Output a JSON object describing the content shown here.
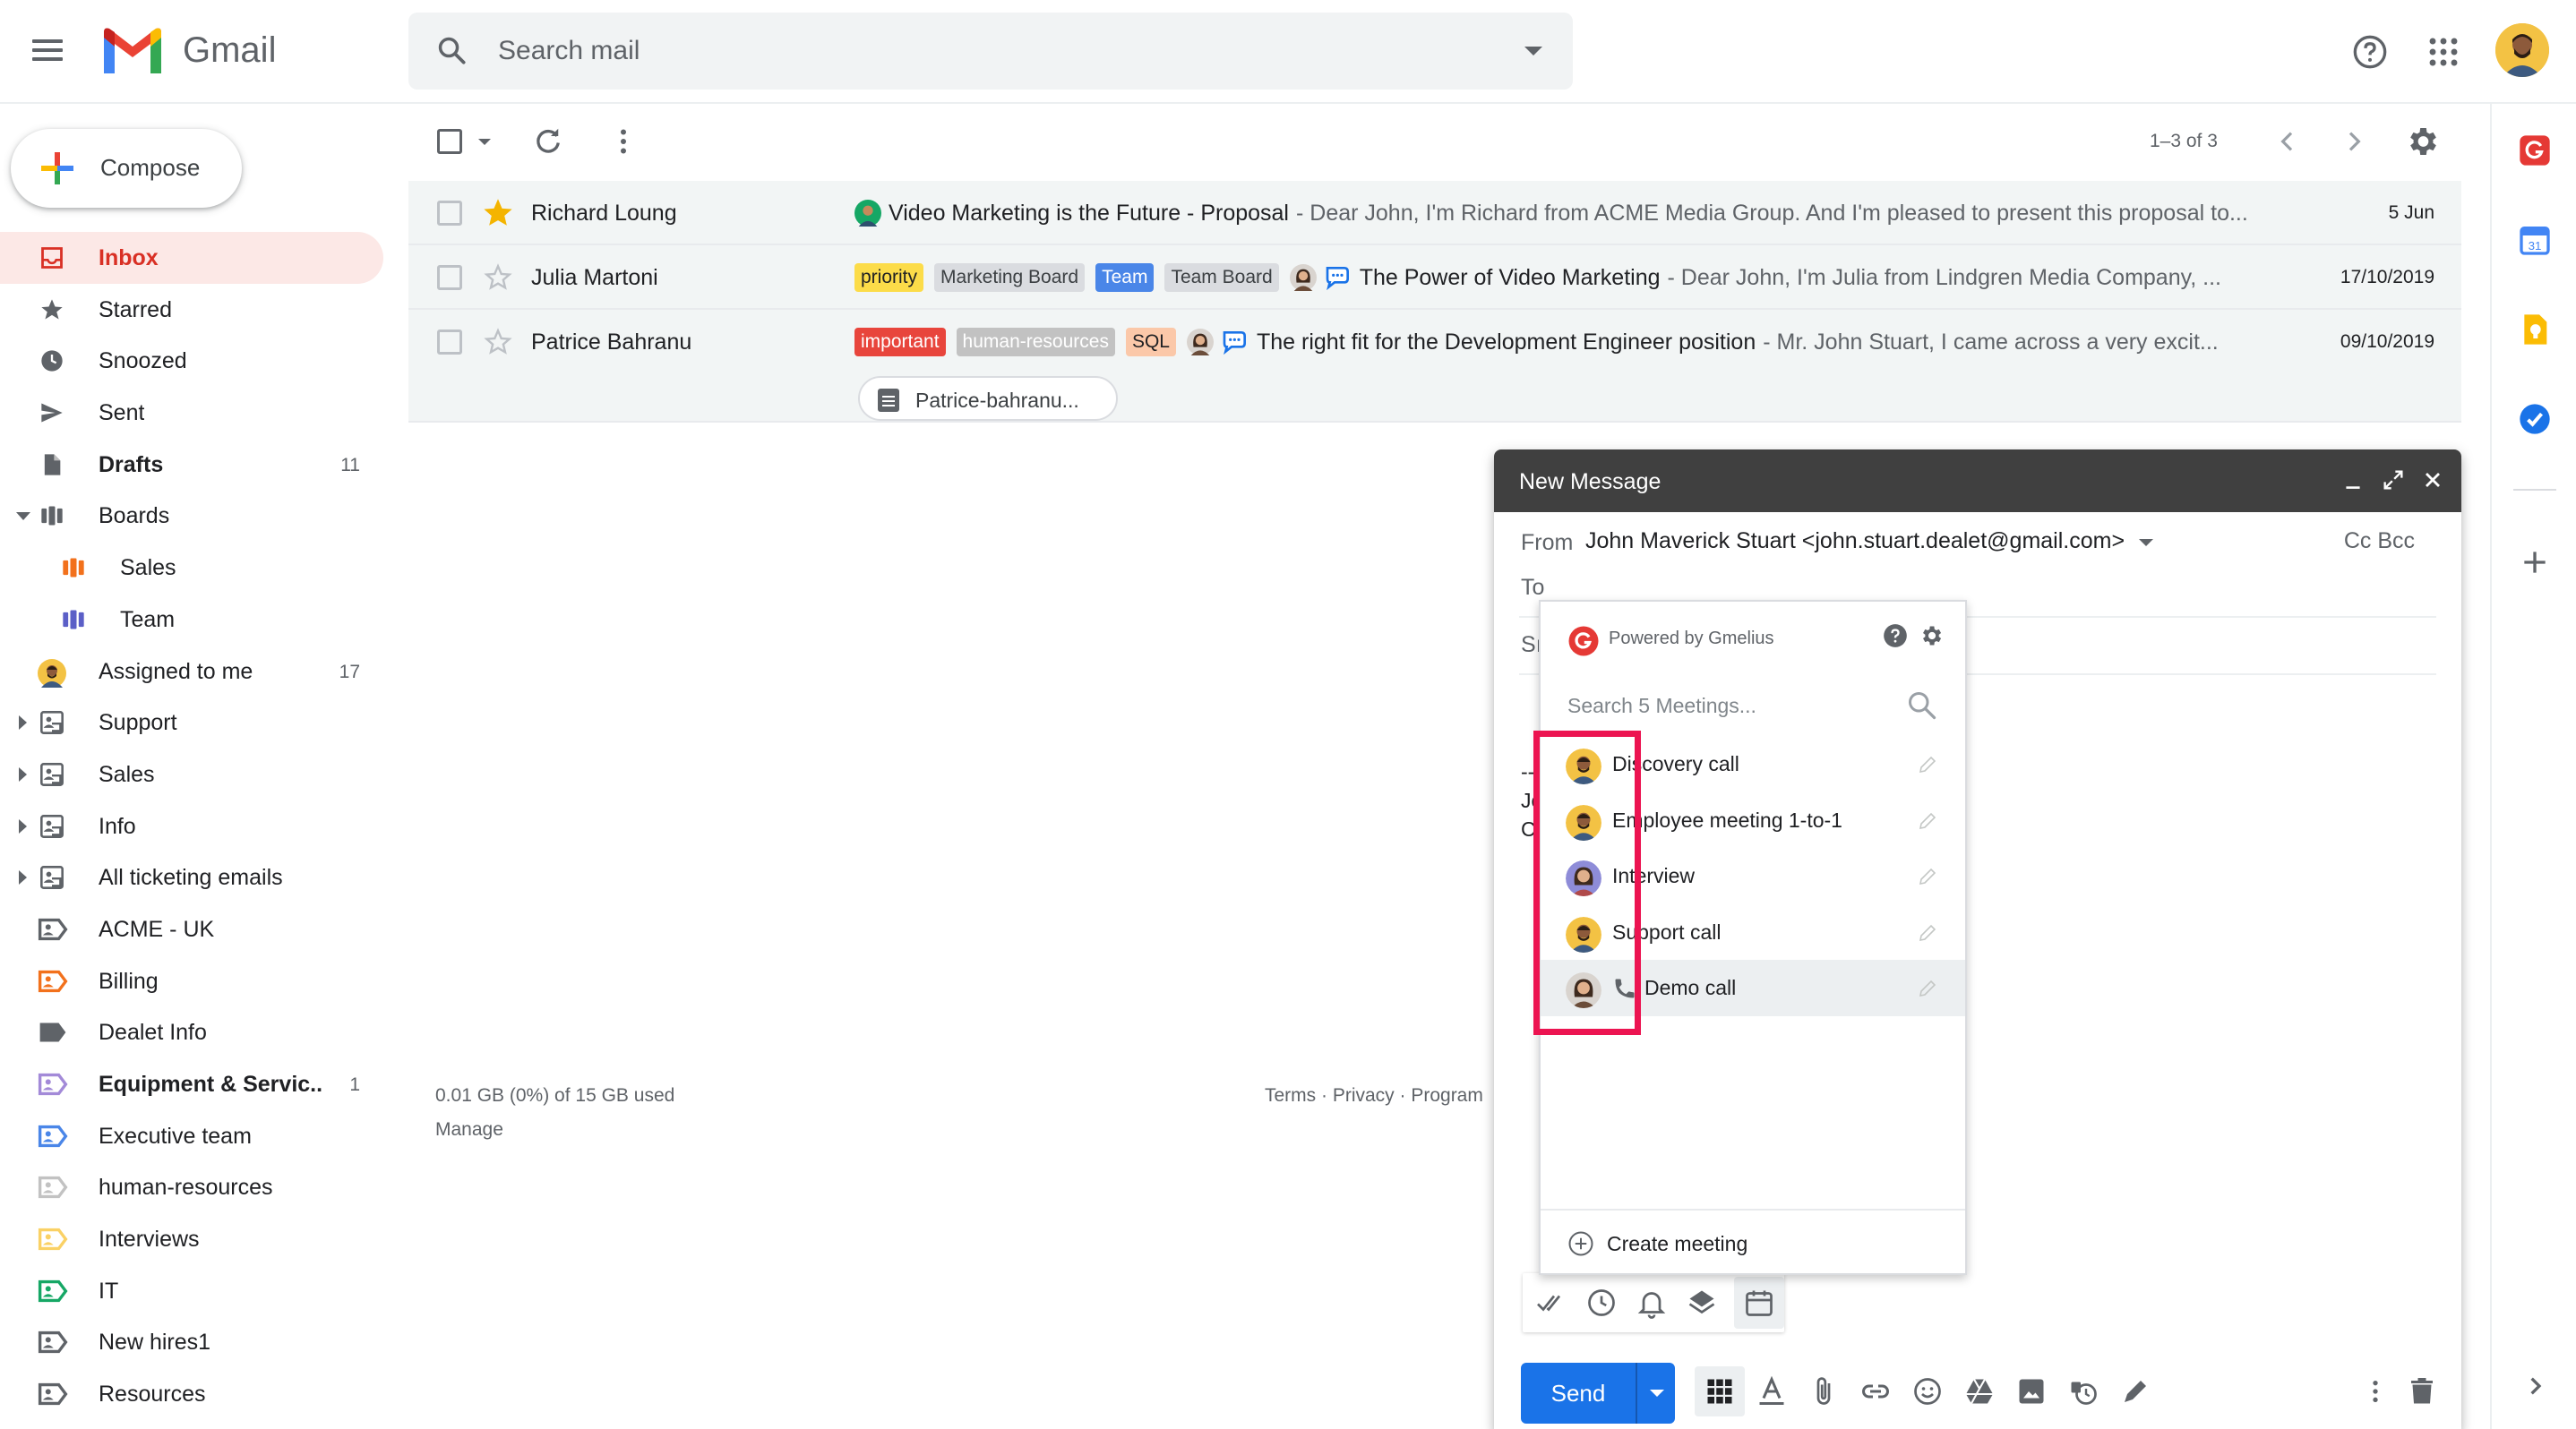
{
  "header": {
    "app_name": "Gmail",
    "search_placeholder": "Search mail"
  },
  "sidebar": {
    "compose_label": "Compose",
    "items": [
      {
        "label": "Inbox",
        "icon": "inbox-icon",
        "active": true
      },
      {
        "label": "Starred",
        "icon": "star-icon"
      },
      {
        "label": "Snoozed",
        "icon": "clock-icon"
      },
      {
        "label": "Sent",
        "icon": "send-icon"
      },
      {
        "label": "Drafts",
        "icon": "draft-icon",
        "count": "11",
        "bold": true
      },
      {
        "label": "Boards",
        "icon": "board-icon",
        "expanded": true
      },
      {
        "label": "Sales",
        "icon": "board-icon",
        "child": true,
        "color": "#f2711c"
      },
      {
        "label": "Team",
        "icon": "board-icon",
        "child": true,
        "color": "#5b5fc7"
      },
      {
        "label": "Assigned to me",
        "icon": "avatar-icon",
        "count": "17"
      },
      {
        "label": "Support",
        "icon": "shared-inbox-icon",
        "collapsed": true
      },
      {
        "label": "Sales",
        "icon": "shared-inbox-icon",
        "collapsed": true
      },
      {
        "label": "Info",
        "icon": "shared-inbox-icon",
        "collapsed": true
      },
      {
        "label": "All ticketing emails",
        "icon": "shared-inbox-icon",
        "collapsed": true
      },
      {
        "label": "ACME - UK",
        "icon": "shared-label-icon",
        "color": "#5f6368"
      },
      {
        "label": "Billing",
        "icon": "shared-label-icon",
        "color": "#f2711c"
      },
      {
        "label": "Dealet Info",
        "icon": "label-icon",
        "color": "#5f6368"
      },
      {
        "label": "Equipment & Servic...",
        "icon": "shared-label-icon",
        "color": "#a38ad8",
        "count": "1",
        "bold": true
      },
      {
        "label": "Executive team",
        "icon": "shared-label-icon",
        "color": "#4a86e8"
      },
      {
        "label": "human-resources",
        "icon": "shared-label-icon",
        "color": "#c2c2c2"
      },
      {
        "label": "Interviews",
        "icon": "shared-label-icon",
        "color": "#fad165"
      },
      {
        "label": "IT",
        "icon": "shared-label-icon",
        "color": "#16a765"
      },
      {
        "label": "New hires1",
        "icon": "shared-label-icon",
        "color": "#5f6368"
      },
      {
        "label": "Resources",
        "icon": "shared-label-icon",
        "color": "#5f6368"
      }
    ]
  },
  "toolbar": {
    "pager": "1–3 of 3"
  },
  "emails": [
    {
      "sender": "Richard Loung",
      "starred": true,
      "labels": [],
      "subject": "Video Marketing is the Future - Proposal",
      "snippet": " - Dear John, I'm Richard from ACME Media Group. And I'm pleased to present this proposal to...",
      "date": "5 Jun"
    },
    {
      "sender": "Julia Martoni",
      "starred": false,
      "labels": [
        {
          "text": "priority",
          "bg": "#fcdc49",
          "fg": "#202124"
        },
        {
          "text": "Marketing Board",
          "bg": "#dadce0",
          "fg": "#3c4043"
        },
        {
          "text": "Team",
          "bg": "#4a86e8",
          "fg": "#ffffff"
        },
        {
          "text": "Team Board",
          "bg": "#dadce0",
          "fg": "#3c4043"
        }
      ],
      "subject": "The Power of Video Marketing",
      "snippet": " - Dear John, I'm Julia from Lindgren Media Company, ...",
      "date": "17/10/2019"
    },
    {
      "sender": "Patrice Bahranu",
      "starred": false,
      "labels": [
        {
          "text": "important",
          "bg": "#e8453c",
          "fg": "#ffffff"
        },
        {
          "text": "human-resources",
          "bg": "#c2c2c2",
          "fg": "#ffffff"
        },
        {
          "text": "SQL",
          "bg": "#fbc8a9",
          "fg": "#202124"
        }
      ],
      "subject": "The right fit for the Development Engineer position",
      "snippet": " - Mr. John Stuart, I came across a very excit...",
      "date": "09/10/2019",
      "attachment": "Patrice-bahranu..."
    }
  ],
  "footer": {
    "storage": "0.01 GB (0%) of 15 GB used",
    "manage": "Manage",
    "links": "Terms · Privacy · Program"
  },
  "compose_window": {
    "title": "New Message",
    "from_label": "From",
    "from_value": "John Maverick Stuart <john.stuart.dealet@gmail.com>",
    "cc_bcc": "Cc Bcc",
    "to_label": "To",
    "subject_partial": "Sı",
    "body_partial": [
      "--",
      "Jo",
      "C"
    ],
    "send_label": "Send"
  },
  "meetings_popup": {
    "powered_by": "Powered by Gmelius",
    "search_placeholder": "Search 5 Meetings...",
    "meetings": [
      {
        "label": "Discovery call",
        "avatar": "man"
      },
      {
        "label": "Employee meeting 1-to-1",
        "avatar": "man"
      },
      {
        "label": "Interview",
        "avatar": "woman-purple"
      },
      {
        "label": "Support call",
        "avatar": "man"
      },
      {
        "label": "Demo call",
        "avatar": "woman",
        "phone": true,
        "hover": true
      }
    ],
    "create_label": "Create meeting"
  },
  "colors": {
    "accent_red": "#d93025",
    "gmelius_red": "#e53935",
    "highlight": "#ec1451",
    "send_blue": "#1a73e8"
  }
}
